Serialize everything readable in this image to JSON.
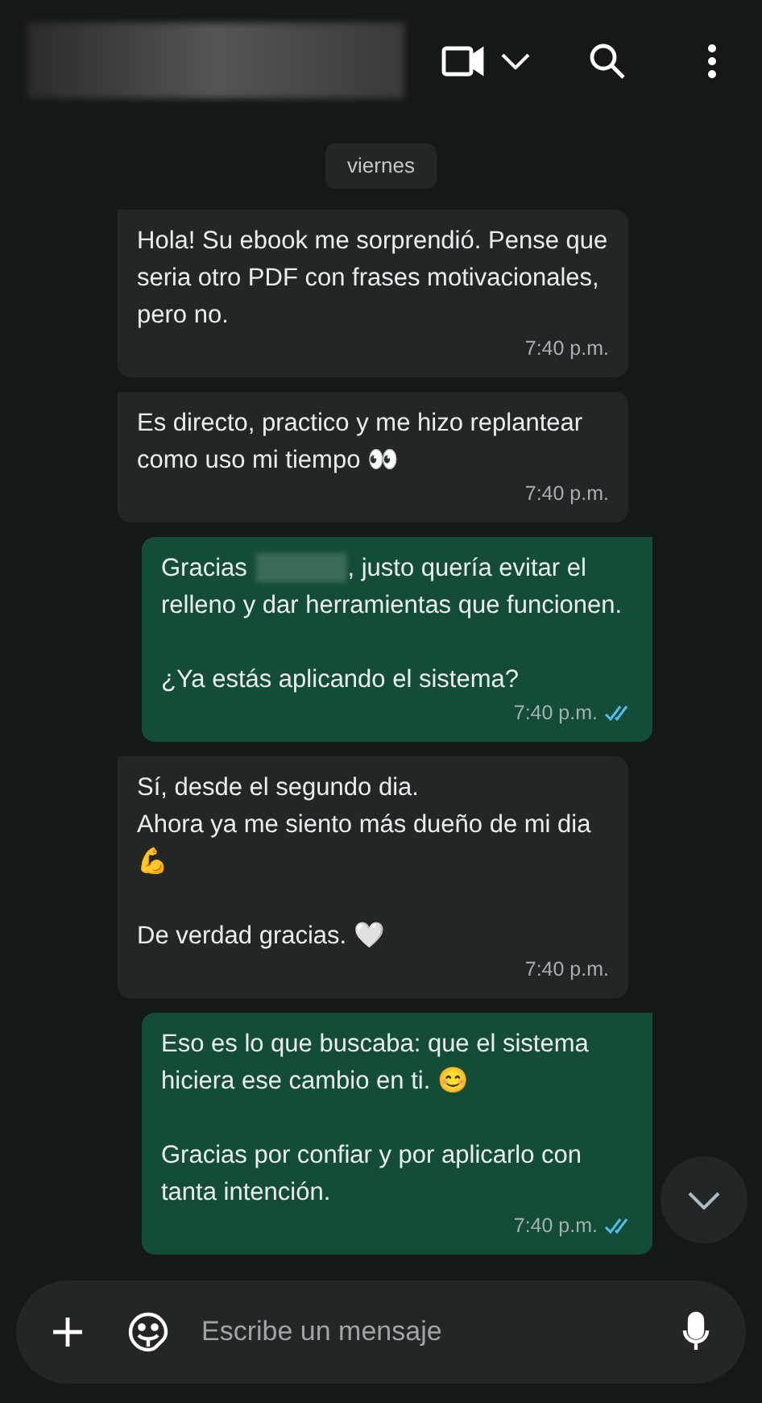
{
  "date_chip": "viernes",
  "messages": [
    {
      "kind": "received",
      "paragraphs": [
        [
          {
            "kind": "text",
            "text": "Hola! Su ebook me sorprendió. Pense que seria otro PDF con frases motivacionales, pero no."
          }
        ]
      ],
      "time": "7:40 p.m."
    },
    {
      "kind": "received",
      "paragraphs": [
        [
          {
            "kind": "text",
            "text": "Es directo, practico y me hizo replantear como uso mi tiempo 👀"
          }
        ]
      ],
      "time": "7:40 p.m."
    },
    {
      "kind": "sent",
      "paragraphs": [
        [
          {
            "kind": "text",
            "text": "Gracias "
          },
          {
            "kind": "redacted"
          },
          {
            "kind": "text",
            "text": ", justo quería evitar el relleno y dar herramientas que funcionen."
          }
        ],
        [
          {
            "kind": "text",
            "text": "¿Ya estás aplicando el sistema?"
          }
        ]
      ],
      "time": "7:40 p.m.",
      "read": true
    },
    {
      "kind": "received",
      "paragraphs": [
        [
          {
            "kind": "text",
            "text": "Sí, desde el segundo dia."
          }
        ],
        [
          {
            "kind": "text",
            "text": "Ahora ya me siento más dueño de mi dia 💪"
          }
        ],
        [
          {
            "kind": "break"
          }
        ],
        [
          {
            "kind": "text",
            "text": "De verdad gracias. 🤍"
          }
        ]
      ],
      "time": "7:40 p.m."
    },
    {
      "kind": "sent",
      "paragraphs": [
        [
          {
            "kind": "text",
            "text": "Eso es lo que buscaba: que el sistema hiciera ese cambio en ti. 😊"
          }
        ],
        [
          {
            "kind": "text",
            "text": "Gracias por confiar y por aplicarlo con tanta intención."
          }
        ]
      ],
      "time": "7:40 p.m.",
      "read": true
    }
  ],
  "composer": {
    "placeholder": "Escribe un mensaje"
  }
}
